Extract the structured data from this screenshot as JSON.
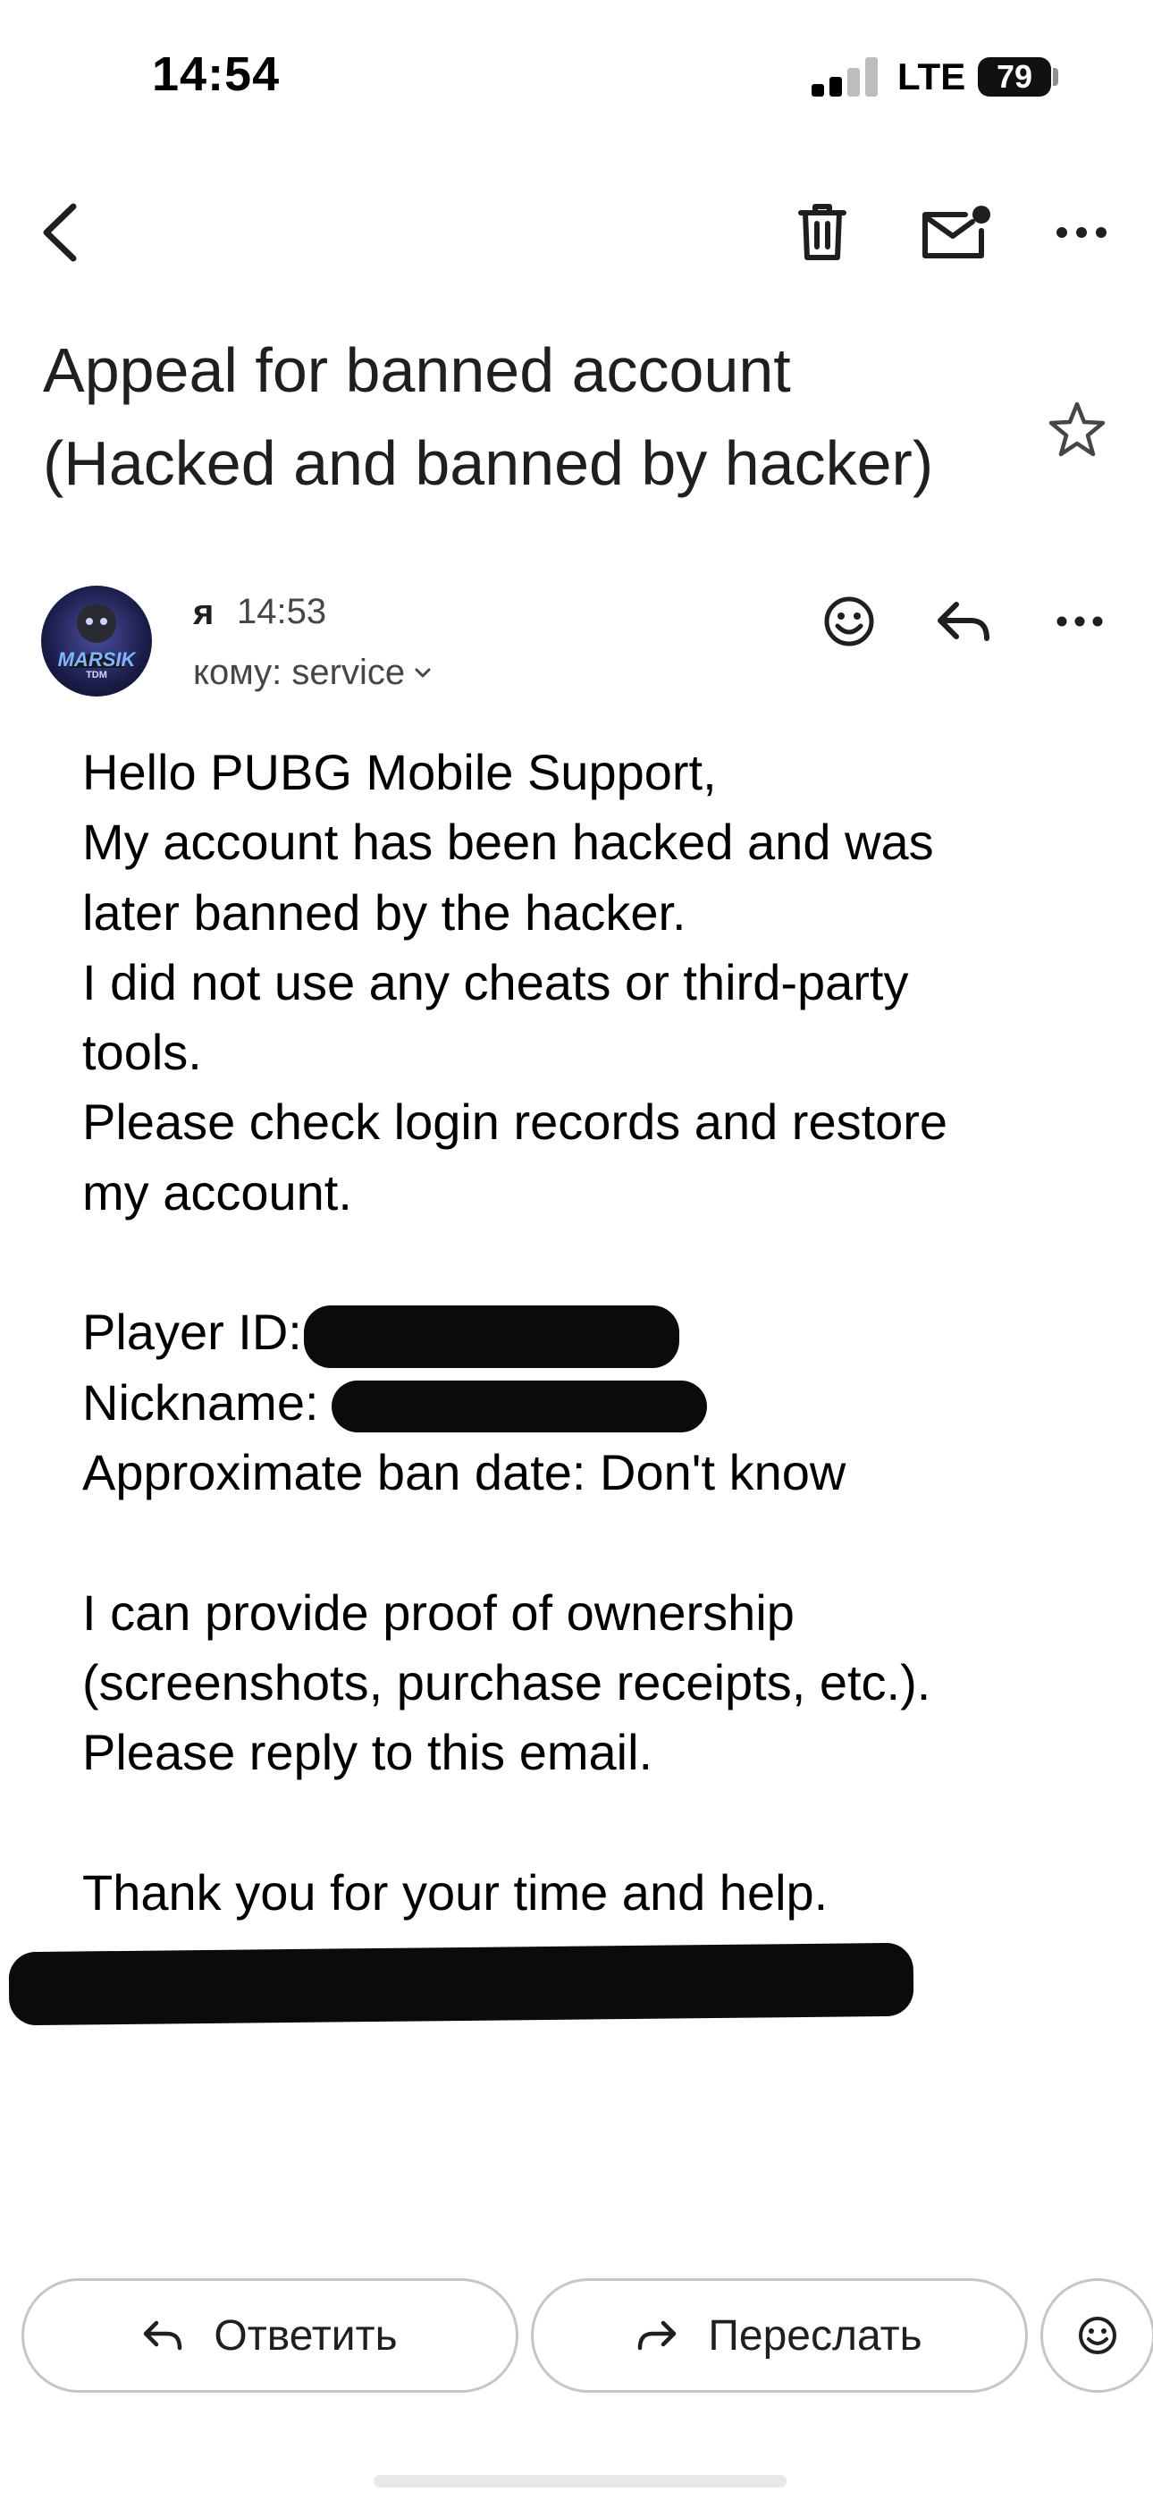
{
  "status_bar": {
    "time": "14:54",
    "network": "LTE",
    "battery": "79"
  },
  "toolbar": {
    "back_icon": "chevron-left-icon",
    "delete_icon": "trash-icon",
    "mark_unread_icon": "mail-unread-icon",
    "more_icon": "more-horizontal-icon"
  },
  "email": {
    "subject_line1": "Appeal for banned account",
    "subject_line2": "(Hacked and banned by hacker)",
    "sender": "я",
    "time": "14:53",
    "recipient": "кому: service",
    "body": {
      "l1": "Hello PUBG Mobile Support,",
      "l2": "My account has been hacked and was",
      "l3": "later banned by the hacker.",
      "l4": "I did not use any cheats or third-party",
      "l5": "tools.",
      "l6": "Please check login records and restore",
      "l7": "my account.",
      "player_id_label": "Player ID:",
      "nickname_label": "Nickname:",
      "ban_date": "Approximate ban date: Don't know",
      "l11": "I can provide proof of ownership",
      "l12": "(screenshots, purchase receipts, etc.).",
      "l13": "Please reply to this email.",
      "l15": "Thank you for your time and help."
    }
  },
  "avatar": {
    "text": "MARSIK",
    "subtext": "TDM"
  },
  "actions": {
    "reply_label": "Ответить",
    "forward_label": "Переслать"
  },
  "colors": {
    "text": "#1f1f1f",
    "secondary": "#444746",
    "outline": "#c4c7c5"
  }
}
